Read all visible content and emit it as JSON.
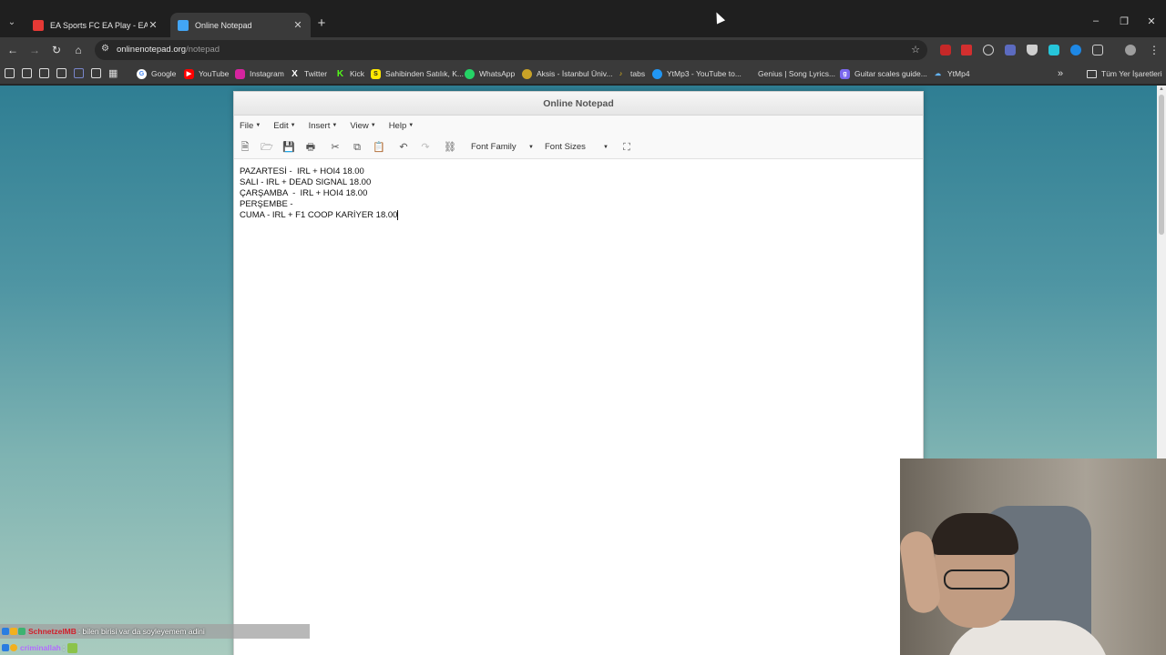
{
  "browser": {
    "tabs": [
      {
        "title": "EA Sports FC EA Play - EA Resmi",
        "favicon_color": "#e53935",
        "active": false
      },
      {
        "title": "Online Notepad",
        "favicon_color": "#42a5f5",
        "active": true
      }
    ],
    "address": {
      "host": "onlinenotepad.org",
      "path": "/notepad"
    },
    "bookmarks": [
      {
        "label": "Google",
        "icon": "google-icon",
        "color": "#ffffff"
      },
      {
        "label": "YouTube",
        "icon": "youtube-icon",
        "color": "#ff0000"
      },
      {
        "label": "Instagram",
        "icon": "instagram-icon",
        "color": "#d6249f"
      },
      {
        "label": "Twitter",
        "icon": "x-icon",
        "color": "#3a3a3a"
      },
      {
        "label": "Kick",
        "icon": "kick-icon",
        "color": "#53fc18"
      },
      {
        "label": "Sahibinden Satılık, K...",
        "icon": "sahibinden-icon",
        "color": "#ffe800"
      },
      {
        "label": "WhatsApp",
        "icon": "whatsapp-icon",
        "color": "#25d366"
      },
      {
        "label": "Aksis - İstanbul Üniv...",
        "icon": "aksis-icon",
        "color": "#c9a227"
      },
      {
        "label": "tabs",
        "icon": "tabs-icon",
        "color": "#f5c518"
      },
      {
        "label": "YtMp3 - YouTube to...",
        "icon": "ytmp3-icon",
        "color": "#2196f3"
      },
      {
        "label": "Genius | Song Lyrics...",
        "icon": "genius-icon",
        "color": "#3a3a3a"
      },
      {
        "label": "Guitar scales guide...",
        "icon": "guitar-icon",
        "color": "#7b68ee"
      },
      {
        "label": "YtMp4",
        "icon": "ytmp4-icon",
        "color": "#3a3a3a"
      }
    ],
    "all_bookmarks_label": "Tüm Yer İşaretleri"
  },
  "notepad": {
    "title": "Online Notepad",
    "menus": [
      "File",
      "Edit",
      "Insert",
      "View",
      "Help"
    ],
    "font_family_label": "Font Family",
    "font_sizes_label": "Font Sizes",
    "lines": [
      "PAZARTESİ -  IRL + HOI4 18.00",
      "SALI - IRL + DEAD SIGNAL 18.00",
      "ÇARŞAMBA  -  IRL + HOI4 18.00",
      "PERŞEMBE - ",
      "CUMA - IRL + F1 COOP KARİYER 18.00"
    ]
  },
  "chat": [
    {
      "user": "SchnetzelMB",
      "user_color": "#d11f2b",
      "message": ": bilen birisi var da soyleyemem adini"
    },
    {
      "user": "criminallah",
      "user_color": "#b36cff",
      "message": ":"
    }
  ]
}
